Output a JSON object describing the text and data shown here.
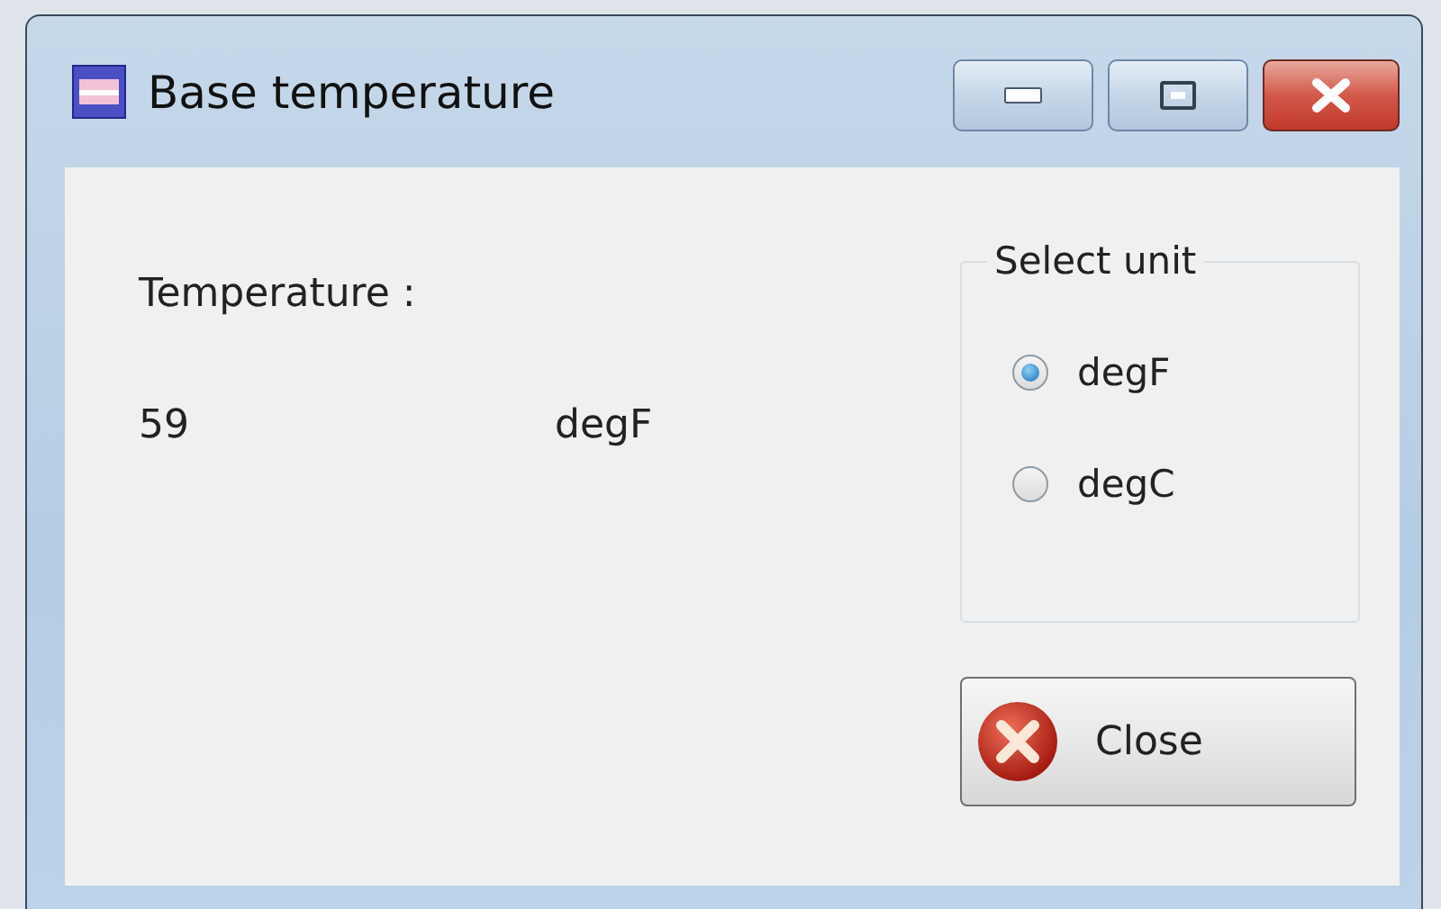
{
  "window": {
    "title": "Base temperature"
  },
  "temperature": {
    "label": "Temperature :",
    "value": "59",
    "unit": "degF"
  },
  "unit_group": {
    "title": "Select unit",
    "options": [
      {
        "label": "degF",
        "selected": true
      },
      {
        "label": "degC",
        "selected": false
      }
    ]
  },
  "buttons": [
    {
      "label": "Close",
      "kind": "close"
    }
  ]
}
